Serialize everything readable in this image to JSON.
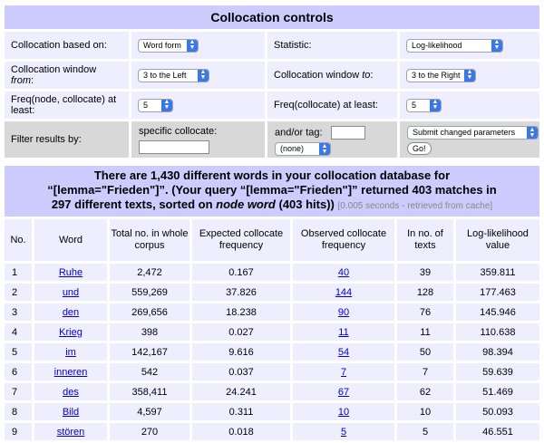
{
  "controls": {
    "title": "Collocation controls",
    "based_on_label": "Collocation based on:",
    "based_on_value": "Word form",
    "statistic_label": "Statistic:",
    "statistic_value": "Log-likelihood",
    "window_from_label": "Collocation window ",
    "window_from_label_em": "from",
    "window_from_label_end": ":",
    "window_from_value": "3 to the Left",
    "window_to_label": "Collocation window ",
    "window_to_label_em": "to",
    "window_to_label_end": ":",
    "window_to_value": "3 to the Right",
    "freq_node_label": "Freq(node, collocate) at least:",
    "freq_node_value": "5",
    "freq_collocate_label": "Freq(collocate) at least:",
    "freq_collocate_value": "5",
    "filter_label": "Filter results by:",
    "specific_collocate_label": "specific collocate:",
    "specific_collocate_value": "",
    "tag_label": "and/or tag:",
    "tag_value": "",
    "tag_select_value": "(none)",
    "submit_select_value": "Submit changed parameters",
    "go_button": "Go!"
  },
  "results": {
    "headline_1": "There are 1,430 different words in your collocation database for",
    "headline_2": "“[lemma=\"Frieden\"]”. (Your query “[lemma=\"Frieden\"]” returned 403 matches in",
    "headline_3a": "297 different texts, sorted on ",
    "headline_3em": "node word",
    "headline_3b": " (403 hits))",
    "timing": "[0.005 seconds - retrieved from cache]",
    "columns": [
      "No.",
      "Word",
      "Total no. in whole corpus",
      "Expected collocate frequency",
      "Observed collocate frequency",
      "In no. of texts",
      "Log-likelihood value"
    ],
    "rows": [
      {
        "no": "1",
        "word": "Ruhe",
        "total": "2,472",
        "expected": "0.167",
        "observed": "40",
        "texts": "39",
        "ll": "359.811"
      },
      {
        "no": "2",
        "word": "und",
        "total": "559,269",
        "expected": "37.826",
        "observed": "144",
        "texts": "128",
        "ll": "177.463"
      },
      {
        "no": "3",
        "word": "den",
        "total": "269,656",
        "expected": "18.238",
        "observed": "90",
        "texts": "76",
        "ll": "145.946"
      },
      {
        "no": "4",
        "word": "Krieg",
        "total": "398",
        "expected": "0.027",
        "observed": "11",
        "texts": "11",
        "ll": "110.638"
      },
      {
        "no": "5",
        "word": "im",
        "total": "142,167",
        "expected": "9.616",
        "observed": "54",
        "texts": "50",
        "ll": "98.394"
      },
      {
        "no": "6",
        "word": "inneren",
        "total": "542",
        "expected": "0.037",
        "observed": "7",
        "texts": "7",
        "ll": "59.639"
      },
      {
        "no": "7",
        "word": "des",
        "total": "358,411",
        "expected": "24.241",
        "observed": "67",
        "texts": "62",
        "ll": "51.469"
      },
      {
        "no": "8",
        "word": "Bild",
        "total": "4,597",
        "expected": "0.311",
        "observed": "10",
        "texts": "10",
        "ll": "50.093"
      },
      {
        "no": "9",
        "word": "stören",
        "total": "270",
        "expected": "0.018",
        "observed": "5",
        "texts": "5",
        "ll": "46.551"
      }
    ]
  }
}
